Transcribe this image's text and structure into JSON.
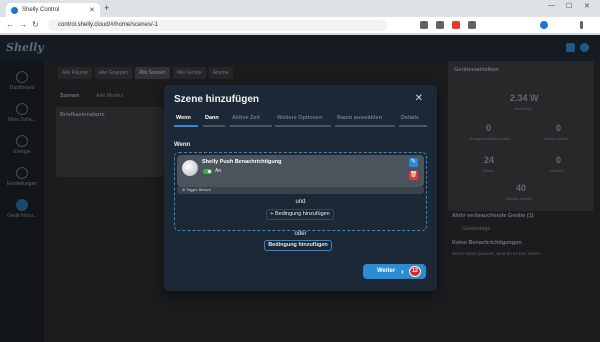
{
  "browser": {
    "tab_title": "Shelly Control",
    "url": "control.shelly.cloud/#/home/scenes/-1"
  },
  "app": {
    "logo": "Shelly",
    "sidebar": [
      {
        "label": "Dashboard"
      },
      {
        "label": "Mein Zuha..."
      },
      {
        "label": "Energie"
      },
      {
        "label": "Einstellungen"
      },
      {
        "label": "Gerät hinzu..."
      }
    ],
    "tabs": [
      "Alle Räume",
      "Alle Gruppen",
      "Alle Szenen",
      "Alle Geräte",
      "Alarme"
    ],
    "section": "Szenen",
    "section_tab": "Alle Modes",
    "card_title": "Briefkastenalarm",
    "stats_title": "Gerätestatistiken",
    "stat_power": "2.34 W",
    "stat_power_label": "Verbrauch",
    "stats": [
      {
        "value": "0",
        "label": "Ausgeschaltete Geräte"
      },
      {
        "value": "0",
        "label": "Offline Geräte"
      },
      {
        "value": "24",
        "label": "Online"
      },
      {
        "value": "0",
        "label": "Inaktive"
      },
      {
        "value": "40",
        "label": "Geräte gesamt"
      }
    ],
    "active_title": "Aktiv verbrauchende Geräte (1)",
    "active_item": "Gästeetage",
    "notif_title": "Keine Benachrichtigungen",
    "notif_text": "Wenn etwas passiert, wirst du es hier sehen."
  },
  "modal": {
    "title": "Szene hinzufügen",
    "close": "✕",
    "steps": [
      "Wenn",
      "Dann",
      "Aktive Zeit",
      "Weitere Optionen",
      "Raum auswählen",
      "Details"
    ],
    "active_step": 0,
    "wenn_label": "Wenn",
    "condition": {
      "name": "Shelly Push Benachrichtigung",
      "toggle_label": "An",
      "toggle_on": true,
      "trigger": "Trigger: Besuch"
    },
    "und": "und",
    "add_inner": "Bedingung hinzufügen",
    "oder": "oder",
    "add_outer": "Bedingung hinzufügen",
    "next": "Weiter",
    "badge": "12"
  },
  "colors": {
    "accent": "#2a8bd6",
    "modal_bg": "#1d2836",
    "danger": "#e53935",
    "toggle": "#39b54a"
  }
}
